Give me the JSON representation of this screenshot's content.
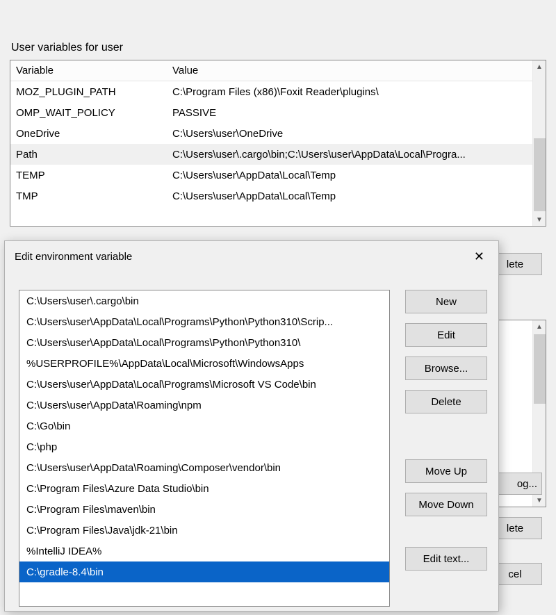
{
  "section_label": "User variables for user",
  "table": {
    "headers": {
      "variable": "Variable",
      "value": "Value"
    },
    "rows": [
      {
        "variable": "MOZ_PLUGIN_PATH",
        "value": "C:\\Program Files (x86)\\Foxit Reader\\plugins\\",
        "selected": false
      },
      {
        "variable": "OMP_WAIT_POLICY",
        "value": "PASSIVE",
        "selected": false
      },
      {
        "variable": "OneDrive",
        "value": "C:\\Users\\user\\OneDrive",
        "selected": false
      },
      {
        "variable": "Path",
        "value": "C:\\Users\\user\\.cargo\\bin;C:\\Users\\user\\AppData\\Local\\Progra...",
        "selected": true
      },
      {
        "variable": "TEMP",
        "value": "C:\\Users\\user\\AppData\\Local\\Temp",
        "selected": false
      },
      {
        "variable": "TMP",
        "value": "C:\\Users\\user\\AppData\\Local\\Temp",
        "selected": false
      }
    ]
  },
  "bg_buttons": {
    "delete1": "lete",
    "og_partial": "og...",
    "delete2": "lete",
    "cancel": "cel"
  },
  "dialog": {
    "title": "Edit environment variable",
    "entries": [
      {
        "text": "C:\\Users\\user\\.cargo\\bin",
        "selected": false
      },
      {
        "text": "C:\\Users\\user\\AppData\\Local\\Programs\\Python\\Python310\\Scrip...",
        "selected": false
      },
      {
        "text": "C:\\Users\\user\\AppData\\Local\\Programs\\Python\\Python310\\",
        "selected": false
      },
      {
        "text": "%USERPROFILE%\\AppData\\Local\\Microsoft\\WindowsApps",
        "selected": false
      },
      {
        "text": "C:\\Users\\user\\AppData\\Local\\Programs\\Microsoft VS Code\\bin",
        "selected": false
      },
      {
        "text": "C:\\Users\\user\\AppData\\Roaming\\npm",
        "selected": false
      },
      {
        "text": "C:\\Go\\bin",
        "selected": false
      },
      {
        "text": "C:\\php",
        "selected": false
      },
      {
        "text": "C:\\Users\\user\\AppData\\Roaming\\Composer\\vendor\\bin",
        "selected": false
      },
      {
        "text": "C:\\Program Files\\Azure Data Studio\\bin",
        "selected": false
      },
      {
        "text": "C:\\Program Files\\maven\\bin",
        "selected": false
      },
      {
        "text": "C:\\Program Files\\Java\\jdk-21\\bin",
        "selected": false
      },
      {
        "text": "%IntelliJ IDEA%",
        "selected": false
      },
      {
        "text": "C:\\gradle-8.4\\bin",
        "selected": true
      }
    ],
    "buttons": {
      "new": "New",
      "edit": "Edit",
      "browse": "Browse...",
      "delete": "Delete",
      "move_up": "Move Up",
      "move_down": "Move Down",
      "edit_text": "Edit text..."
    }
  }
}
